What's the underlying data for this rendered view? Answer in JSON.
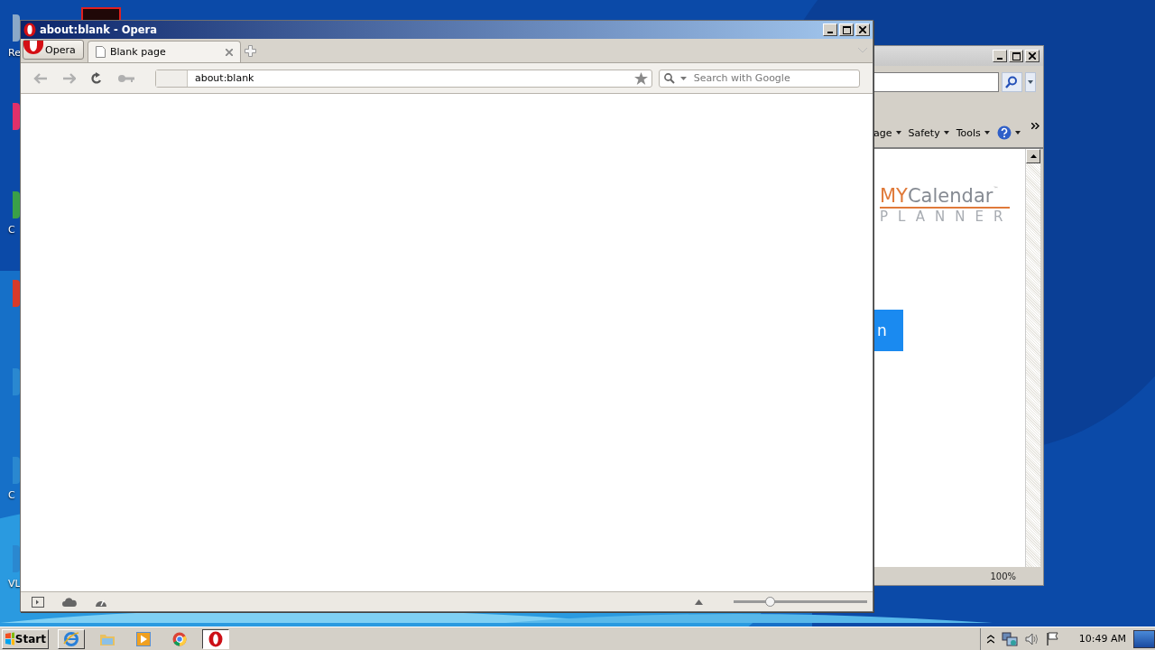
{
  "desktop": {
    "icons": [
      {
        "label": "Re",
        "color": "#8aa8c8"
      },
      {
        "color": "#e0306a"
      },
      {
        "label": "C",
        "color": "#3aa048"
      },
      {
        "color": "#d83a2a"
      },
      {
        "color": "#2a88d0"
      },
      {
        "label": "C",
        "color": "#2a88d0"
      },
      {
        "label": "VL",
        "color": "#2a88d0"
      }
    ]
  },
  "ie_window": {
    "command_bar": [
      "age",
      "Safety",
      "Tools"
    ],
    "logo": {
      "prefix": "MY",
      "main": "Calendar",
      "tm": "™",
      "sub": "PLANNER"
    },
    "page_button": "n",
    "zoom": "100%"
  },
  "opera_window": {
    "title": "about:blank - Opera",
    "menu_button": "Opera",
    "tabs": [
      {
        "label": "Blank page",
        "selected": true
      }
    ],
    "address": "about:blank",
    "search": {
      "placeholder": "Search with Google"
    },
    "zoom_slider": {
      "level": 0.28
    }
  },
  "taskbar": {
    "start": "Start",
    "apps": [
      {
        "kind": "ie",
        "running": true
      },
      {
        "kind": "explorer",
        "running": false
      },
      {
        "kind": "media",
        "running": false
      },
      {
        "kind": "chrome",
        "running": false
      },
      {
        "kind": "opera",
        "running": true
      }
    ],
    "clock": "10:49 AM"
  }
}
